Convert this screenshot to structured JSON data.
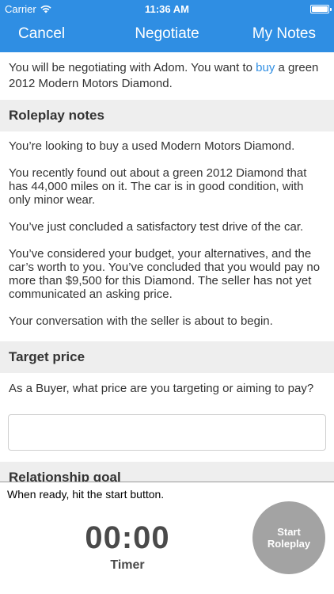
{
  "status_bar": {
    "carrier": "Carrier",
    "time": "11:36 AM",
    "wifi_icon": "wifi-icon",
    "battery_icon": "battery-icon"
  },
  "nav": {
    "left_label": "Cancel",
    "title": "Negotiate",
    "right_label": "My Notes",
    "bar_color": "#2f8ee3"
  },
  "intro": {
    "text_before": "You will be negotiating with Adom. You want to ",
    "link_text": "buy",
    "text_after": " a green 2012 Modern Motors Diamond.",
    "link_color": "#2f8ee3"
  },
  "roleplay": {
    "header": "Roleplay notes",
    "paragraphs": [
      "You’re looking to buy a used Modern Motors Diamond.",
      "You recently found out about a green 2012 Diamond that has 44,000 miles on it. The car is in good condition, with only minor wear.",
      "You’ve just concluded a satisfactory test drive of the car.",
      "You’ve considered your budget, your alternatives, and the car’s worth to you. You’ve concluded that you would pay no more than $9,500 for this Diamond. The seller has not yet communicated an asking price.",
      "Your conversation with the seller is about to begin."
    ]
  },
  "target_price": {
    "header": "Target price",
    "question": "As a Buyer, what price are you targeting or aiming to pay?",
    "input_value": "",
    "input_placeholder": ""
  },
  "relationship_goal": {
    "header": "Relationship goal"
  },
  "bottom": {
    "hint": "When ready, hit the start button.",
    "timer_value": "00:00",
    "timer_label": "Timer",
    "start_line1": "Start",
    "start_line2": "Roleplay"
  }
}
